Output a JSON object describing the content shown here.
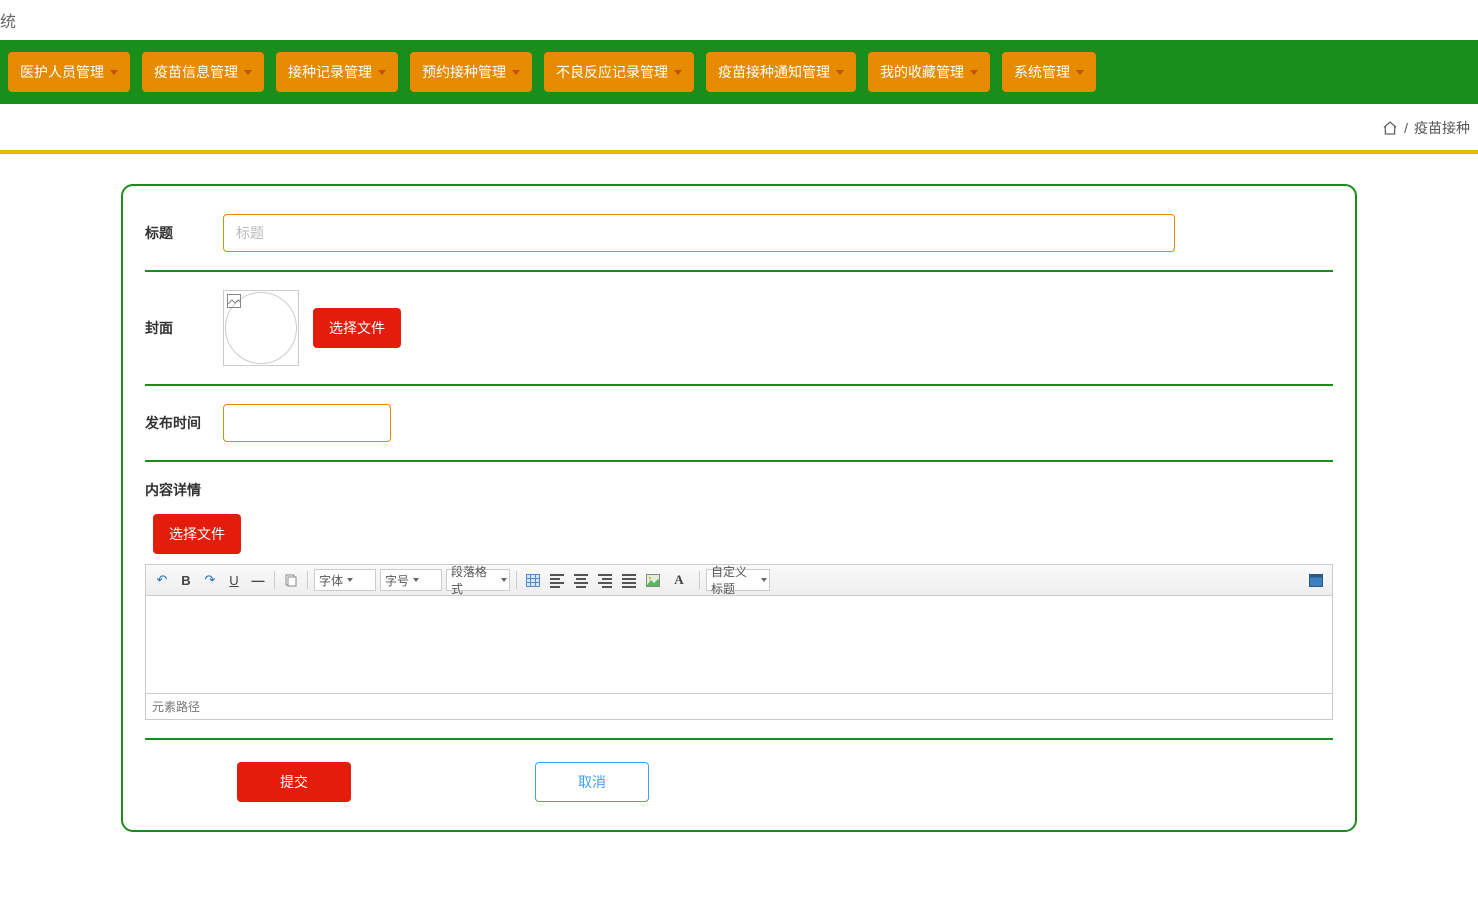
{
  "header": {
    "partial_title": "统"
  },
  "nav": {
    "items": [
      {
        "label": "医护人员管理"
      },
      {
        "label": "疫苗信息管理"
      },
      {
        "label": "接种记录管理"
      },
      {
        "label": "预约接种管理"
      },
      {
        "label": "不良反应记录管理"
      },
      {
        "label": "疫苗接种通知管理"
      },
      {
        "label": "我的收藏管理"
      },
      {
        "label": "系统管理"
      }
    ]
  },
  "breadcrumb": {
    "separator": "/",
    "page": "疫苗接种"
  },
  "form": {
    "title": {
      "label": "标题",
      "placeholder": "标题",
      "value": ""
    },
    "cover": {
      "label": "封面",
      "choose_file": "选择文件"
    },
    "publish_time": {
      "label": "发布时间",
      "value": ""
    },
    "detail": {
      "label": "内容详情",
      "choose_file": "选择文件"
    },
    "editor": {
      "font_family": "字体",
      "font_size": "字号",
      "paragraph_format": "段落格式",
      "custom_title": "自定义标题",
      "footer": "元素路径"
    },
    "actions": {
      "submit": "提交",
      "cancel": "取消"
    }
  }
}
